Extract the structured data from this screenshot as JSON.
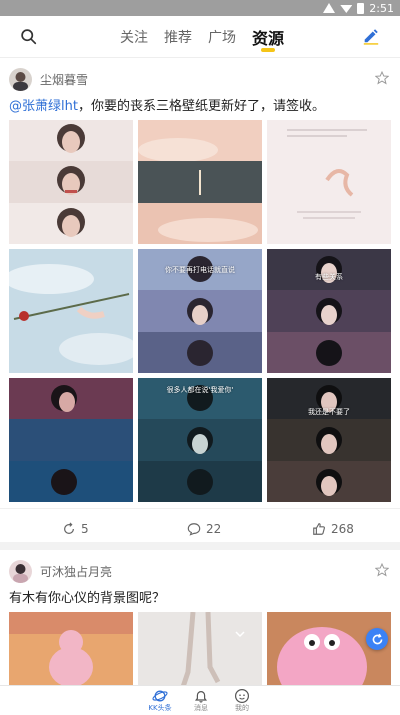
{
  "status_bar": {
    "time": "2:51"
  },
  "top_nav": {
    "tabs": [
      {
        "label": "关注",
        "active": false
      },
      {
        "label": "推荐",
        "active": false
      },
      {
        "label": "广场",
        "active": false
      },
      {
        "label": "资源",
        "active": true
      }
    ]
  },
  "posts": [
    {
      "username": "尘烟暮雪",
      "mention": "@张萧绿lht",
      "text": "，你要的丧系三格壁纸更新好了，请签收。",
      "images": [
        {
          "name": "girl-portrait-light",
          "colors": [
            "#efe6e4",
            "#d9c7c6"
          ],
          "caption": ""
        },
        {
          "name": "rocket-sky",
          "colors": [
            "#f3d8c9",
            "#4a5356"
          ],
          "caption": ""
        },
        {
          "name": "hand-text-quote",
          "colors": [
            "#f4ecec",
            "#e3d8dc"
          ],
          "caption": "我这一个小孩多么好"
        },
        {
          "name": "hand-rose-sky",
          "colors": [
            "#bcd3e0",
            "#e4edf2"
          ],
          "caption": ""
        },
        {
          "name": "girl-subtitle-1",
          "colors": [
            "#96a6c8",
            "#5a6288"
          ],
          "caption": "你不要再打电话就直说"
        },
        {
          "name": "girl-subtitle-2",
          "colors": [
            "#3b3746",
            "#6b4f66"
          ],
          "caption": "有些关系"
        },
        {
          "name": "girl-blue-dark",
          "colors": [
            "#1e4f7a",
            "#2b3f5c"
          ],
          "caption": ""
        },
        {
          "name": "girl-teal-dark",
          "colors": [
            "#2c5a6e",
            "#1e3a48"
          ],
          "caption": "很多人都在说'我爱你'"
        },
        {
          "name": "girl-dark-smile",
          "colors": [
            "#26282c",
            "#4a3d3a"
          ],
          "caption": "我还是不要了"
        }
      ],
      "actions": {
        "share": "5",
        "comment": "22",
        "like": "268"
      }
    },
    {
      "username": "可沐独占月亮",
      "text": "有木有你心仪的背景图呢？",
      "images": [
        {
          "name": "pink-panther-room",
          "colors": [
            "#e8a66f",
            "#d98b6a"
          ]
        },
        {
          "name": "dancer-legs",
          "colors": [
            "#e9e6e4",
            "#c9c4c0"
          ]
        },
        {
          "name": "patrick-star",
          "colors": [
            "#f3a6c5",
            "#c96ea0"
          ]
        }
      ]
    }
  ],
  "bottom_nav": {
    "items": [
      {
        "label": "KK头条",
        "active": true
      },
      {
        "label": "消息",
        "active": false
      },
      {
        "label": "我的",
        "active": false
      }
    ]
  },
  "colors": {
    "accent": "#2f6fd6",
    "tab_underline": "#f5c518"
  }
}
